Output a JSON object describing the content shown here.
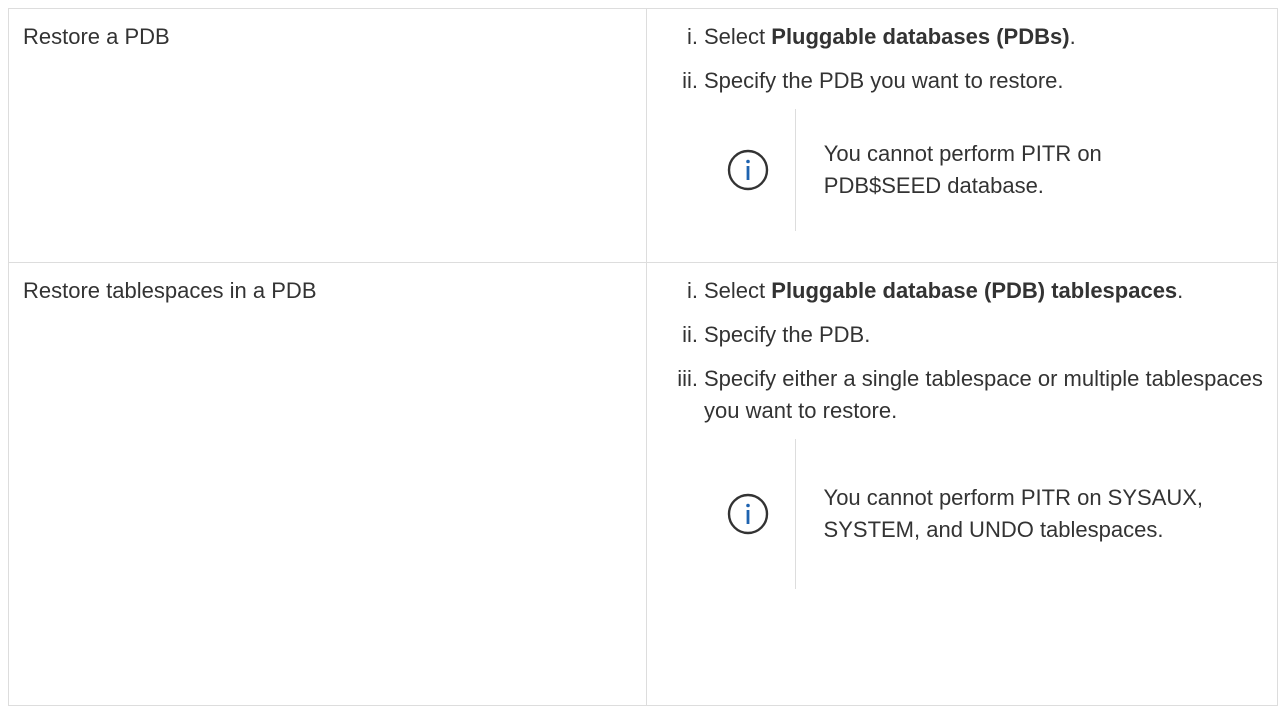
{
  "rows": [
    {
      "action": "Restore a PDB",
      "steps": [
        {
          "num": "i.",
          "pre": "Select ",
          "bold": "Pluggable databases (PDBs)",
          "post": "."
        },
        {
          "num": "ii.",
          "pre": "Specify the PDB you want to restore.",
          "bold": "",
          "post": ""
        }
      ],
      "note": {
        "icon": "info-icon",
        "text": "You cannot perform PITR on PDB$SEED database."
      }
    },
    {
      "action": "Restore tablespaces in a PDB",
      "steps": [
        {
          "num": "i.",
          "pre": "Select ",
          "bold": "Pluggable database (PDB) tablespaces",
          "post": "."
        },
        {
          "num": "ii.",
          "pre": "Specify the PDB.",
          "bold": "",
          "post": ""
        },
        {
          "num": "iii.",
          "pre": "Specify either a single tablespace or multiple tablespaces you want to restore.",
          "bold": "",
          "post": ""
        }
      ],
      "note": {
        "icon": "info-icon",
        "text": "You cannot perform PITR on SYSAUX, SYSTEM, and UNDO tablespaces."
      }
    }
  ],
  "colors": {
    "text": "#333333",
    "border": "#dddddd",
    "icon": "#1e63b0"
  }
}
